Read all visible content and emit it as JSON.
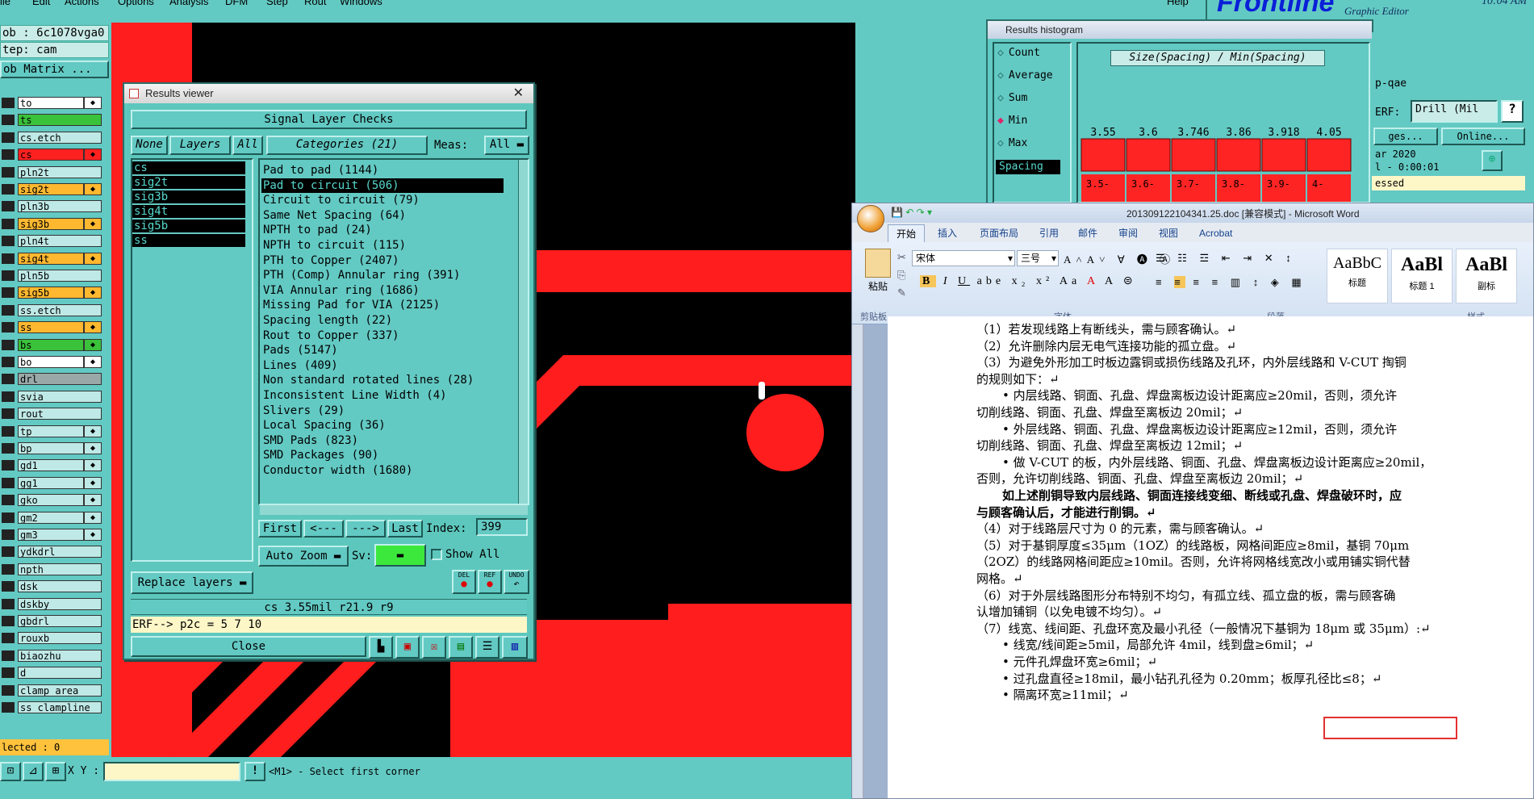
{
  "menubar": {
    "items": [
      "ile",
      "Edit",
      "Actions",
      "Options",
      "Analysis",
      "DFM",
      "Step",
      "Rout",
      "Windows"
    ],
    "help": "Help",
    "brand": "Frontline",
    "brand_sub": "Graphic Editor",
    "time": "10:04 AM"
  },
  "left_panel": {
    "job": "ob : 6c1078vga0",
    "step": "tep: cam",
    "matrix": "ob Matrix ...",
    "layers": [
      {
        "name": "to",
        "color": "#ffffff",
        "badge": true
      },
      {
        "name": "ts",
        "color": "#3ac23a"
      },
      {
        "name": "cs.etch",
        "color": "#bfe9e6"
      },
      {
        "name": "cs",
        "color": "#ff2020",
        "badge": true
      },
      {
        "name": "pln2t",
        "color": "#bfe9e6"
      },
      {
        "name": "sig2t",
        "color": "#ffb830",
        "badge": true
      },
      {
        "name": "pln3b",
        "color": "#bfe9e6"
      },
      {
        "name": "sig3b",
        "color": "#ffb830",
        "badge": true
      },
      {
        "name": "pln4t",
        "color": "#bfe9e6"
      },
      {
        "name": "sig4t",
        "color": "#ffb830",
        "badge": true
      },
      {
        "name": "pln5b",
        "color": "#bfe9e6"
      },
      {
        "name": "sig5b",
        "color": "#ffb830",
        "badge": true
      },
      {
        "name": "ss.etch",
        "color": "#bfe9e6"
      },
      {
        "name": "ss",
        "color": "#ffb830",
        "badge": true
      },
      {
        "name": "bs",
        "color": "#3ac23a",
        "badge": true
      },
      {
        "name": "bo",
        "color": "#ffffff",
        "badge": true
      },
      {
        "name": "drl",
        "color": "#9aa9a8"
      },
      {
        "name": "svia",
        "color": "#bfe9e6"
      },
      {
        "name": "rout",
        "color": "#bfe9e6"
      },
      {
        "name": "tp",
        "color": "#bfe9e6",
        "badge": true
      },
      {
        "name": "bp",
        "color": "#bfe9e6",
        "badge": true
      },
      {
        "name": "gd1",
        "color": "#bfe9e6",
        "badge": true
      },
      {
        "name": "gg1",
        "color": "#bfe9e6",
        "badge": true
      },
      {
        "name": "gko",
        "color": "#bfe9e6",
        "badge": true
      },
      {
        "name": "gm2",
        "color": "#bfe9e6",
        "badge": true
      },
      {
        "name": "gm3",
        "color": "#bfe9e6",
        "badge": true
      },
      {
        "name": "ydkdrl",
        "color": "#bfe9e6"
      },
      {
        "name": "npth",
        "color": "#bfe9e6"
      },
      {
        "name": "dsk",
        "color": "#bfe9e6"
      },
      {
        "name": "dskby",
        "color": "#bfe9e6"
      },
      {
        "name": "gbdrl",
        "color": "#bfe9e6"
      },
      {
        "name": "rouxb",
        "color": "#bfe9e6"
      },
      {
        "name": "biaozhu",
        "color": "#bfe9e6"
      },
      {
        "name": "d",
        "color": "#bfe9e6"
      },
      {
        "name": "clamp_area",
        "color": "#bfe9e6"
      },
      {
        "name": "ss_clampline",
        "color": "#bfe9e6"
      }
    ],
    "selected": "lected : 0"
  },
  "statusbar": {
    "xy_label": "X Y :",
    "xy_value": "",
    "message": "<M1> - Select first corner"
  },
  "results_viewer": {
    "title": "Results viewer",
    "header": "Signal Layer Checks",
    "none_btn": "None",
    "layers_btn": "Layers",
    "all_btn": "All",
    "categories_btn": "Categories (21)",
    "meas_label": "Meas:",
    "meas_value": "All",
    "layers": [
      "cs",
      "sig2t",
      "sig3b",
      "sig4t",
      "sig5b",
      "ss"
    ],
    "categories": [
      "Pad to pad (1144)",
      "Pad to circuit (506)",
      "Circuit to circuit (79)",
      "Same Net Spacing (64)",
      "NPTH to pad (24)",
      "NPTH to circuit (115)",
      "PTH to Copper (2407)",
      "PTH (Comp) Annular ring (391)",
      "VIA Annular ring (1686)",
      "Missing Pad for VIA (2125)",
      "Spacing length (22)",
      "Rout to Copper (337)",
      "Pads (5147)",
      "Lines (409)",
      "Non standard rotated lines (28)",
      "Inconsistent Line Width (4)",
      "Slivers (29)",
      "Local Spacing (36)",
      "SMD Pads (823)",
      "SMD Packages (90)",
      "Conductor width (1680)"
    ],
    "selected_category": "Pad to circuit (506)",
    "first_btn": "First",
    "prev_btn": "<---",
    "next_btn": "--->",
    "last_btn": "Last",
    "index_label": "Index:",
    "index_value": "399",
    "autozoom_btn": "Auto Zoom",
    "sv_label": "Sv:",
    "showall_label": "Show All",
    "replace_btn": "Replace layers",
    "del_label": "DEL",
    "ref_label": "REF",
    "undo_label": "UNDO",
    "result_line": "cs 3.55mil  r21.9  r9",
    "erf_line": "ERF--> p2c = 5 7 10",
    "close_btn": "Close"
  },
  "histogram": {
    "title": "Results histogram",
    "options": [
      "Count",
      "Average",
      "Sum",
      "Min",
      "Max"
    ],
    "selected_option": "Min",
    "field_label": "Spacing",
    "chart_title": "Size(Spacing) / Min(Spacing)",
    "bar_values": [
      "3.55",
      "3.6",
      "3.746",
      "3.86",
      "3.918",
      "4.05"
    ],
    "bar_ranges": [
      "3.5-",
      "3.6-",
      "3.7-",
      "3.8-",
      "3.9-",
      "4-"
    ],
    "bar_color": "#ff2424"
  },
  "right_panel": {
    "label_qae": "p-qae",
    "erf_label": "ERF:",
    "erf_value": "Drill (Mil",
    "ges_btn": "ges...",
    "online_btn": "Online...",
    "date": "ar 2020",
    "elapsed": "l - 0:00:01",
    "status": "essed"
  },
  "word": {
    "title": "201309122104341.25.doc [兼容模式] - Microsoft Word",
    "tabs": [
      "开始",
      "插入",
      "页面布局",
      "引用",
      "邮件",
      "审阅",
      "视图",
      "Acrobat"
    ],
    "font_name": "宋体",
    "font_size": "三号",
    "groups": [
      "剪贴板",
      "字体",
      "段落",
      "样式"
    ],
    "paste_label": "粘贴",
    "styles": [
      {
        "preview": "AaBbC",
        "name": "标题"
      },
      {
        "preview": "AaBl",
        "name": "标题 1"
      },
      {
        "preview": "AaBl",
        "name": "副标"
      }
    ],
    "lines": [
      {
        "text": "（1）若发现线路上有断线头，需与顾客确认。↵",
        "indent": 0
      },
      {
        "text": "（2）允许删除内层无电气连接功能的孤立盘。↵",
        "indent": 0
      },
      {
        "text": "（3）为避免外形加工时板边露铜或损伤线路及孔环，内外层线路和 V-CUT 掏铜",
        "indent": 0
      },
      {
        "text": "的规则如下：↵",
        "indent": 0
      },
      {
        "text": "• 内层线路、铜面、孔盘、焊盘离板边设计距离应≥20mil，否则，须允许",
        "indent": 2
      },
      {
        "text": "切削线路、铜面、孔盘、焊盘至离板边 20mil；↵",
        "indent": 0
      },
      {
        "text": "• 外层线路、铜面、孔盘、焊盘离板边设计距离应≥12mil，否则，须允许",
        "indent": 2
      },
      {
        "text": "切削线路、铜面、孔盘、焊盘至离板边 12mil；↵",
        "indent": 0
      },
      {
        "text": "• 做 V-CUT 的板，内外层线路、铜面、孔盘、焊盘离板边设计距离应≥20mil，",
        "indent": 2
      },
      {
        "text": "否则，允许切削线路、铜面、孔盘、焊盘至离板边 20mil；↵",
        "indent": 0
      },
      {
        "text": "如上述削铜导致内层线路、铜面连接线变细、断线或孔盘、焊盘破环时，应",
        "indent": 2,
        "bold": true
      },
      {
        "text": "与顾客确认后，才能进行削铜。↵",
        "indent": 0,
        "bold": true
      },
      {
        "text": "（4）对于线路层尺寸为 0 的元素，需与顾客确认。↵",
        "indent": 0
      },
      {
        "text": "（5）对于基铜厚度≤35μm（1OZ）的线路板，网格间距应≥8mil，基铜 70μm",
        "indent": 0
      },
      {
        "text": "（2OZ）的线路网格间距应≥10mil。否则，允许将网格线宽改小或用铺实铜代替",
        "indent": 0
      },
      {
        "text": "网格。↵",
        "indent": 0
      },
      {
        "text": "（6）对于外层线路图形分布特别不均匀，有孤立线、孤立盘的板，需与顾客确",
        "indent": 0
      },
      {
        "text": "认增加铺铜（以免电镀不均匀）。↵",
        "indent": 0
      },
      {
        "text": "（7）线宽、线间距、孔盘环宽及最小孔径（一般情况下基铜为 18μm 或 35μm）:↵",
        "indent": 0
      },
      {
        "text": "• 线宽/线间距≥5mil，局部允许 4mil，线到盘≥6mil；↵",
        "indent": 2
      },
      {
        "text": "• 元件孔焊盘环宽≥6mil；↵",
        "indent": 2
      },
      {
        "text": "• 过孔盘直径≥18mil，最小钻孔孔径为 0.20mm；板厚孔径比≤8；↵",
        "indent": 2
      },
      {
        "text": "• 隔离环宽≥11mil；↵",
        "indent": 2
      }
    ]
  }
}
